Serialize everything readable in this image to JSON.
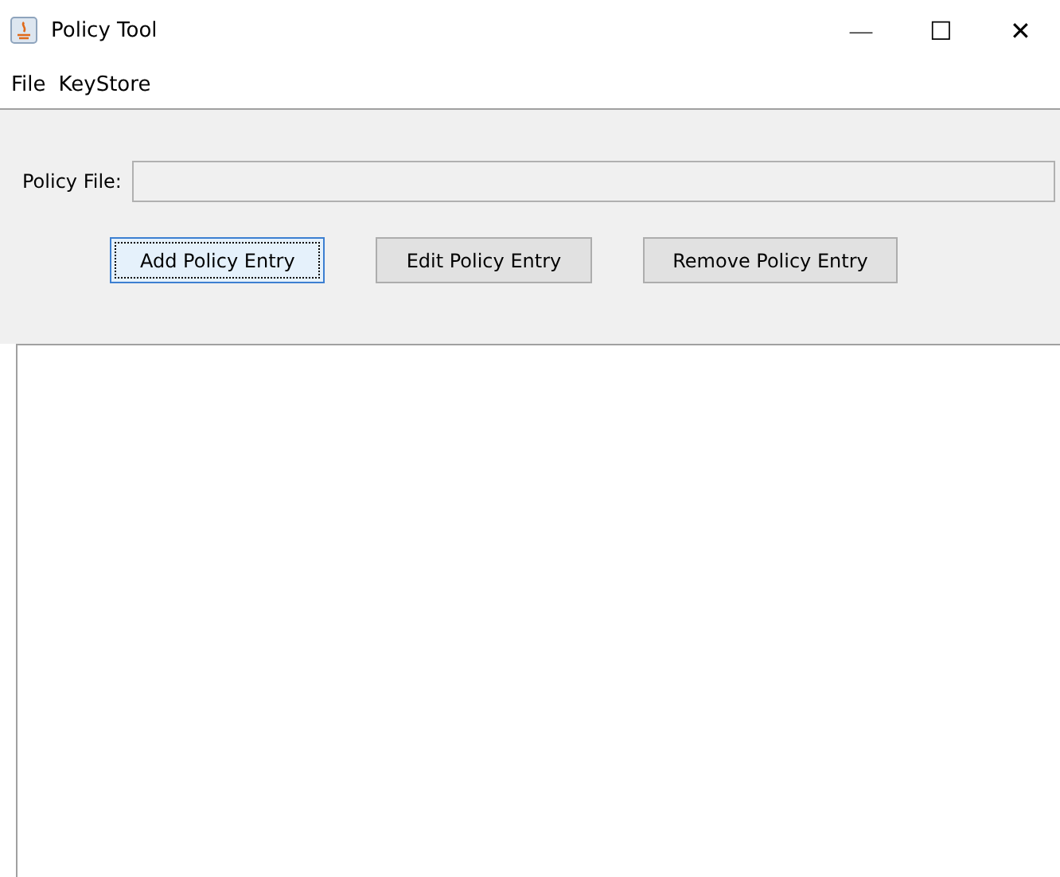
{
  "window": {
    "title": "Policy Tool",
    "controls": [
      "—",
      "☐",
      "✕"
    ]
  },
  "menu": [
    "File",
    "KeyStore"
  ],
  "policy_file": {
    "label": "Policy File:",
    "disabled": true
  },
  "buttons": [
    {
      "label": "Add Policy Entry",
      "focused": true
    },
    {
      "label": "Edit Policy Entry",
      "focused": false
    },
    {
      "label": "Remove Policy Entry",
      "focused": false
    }
  ]
}
